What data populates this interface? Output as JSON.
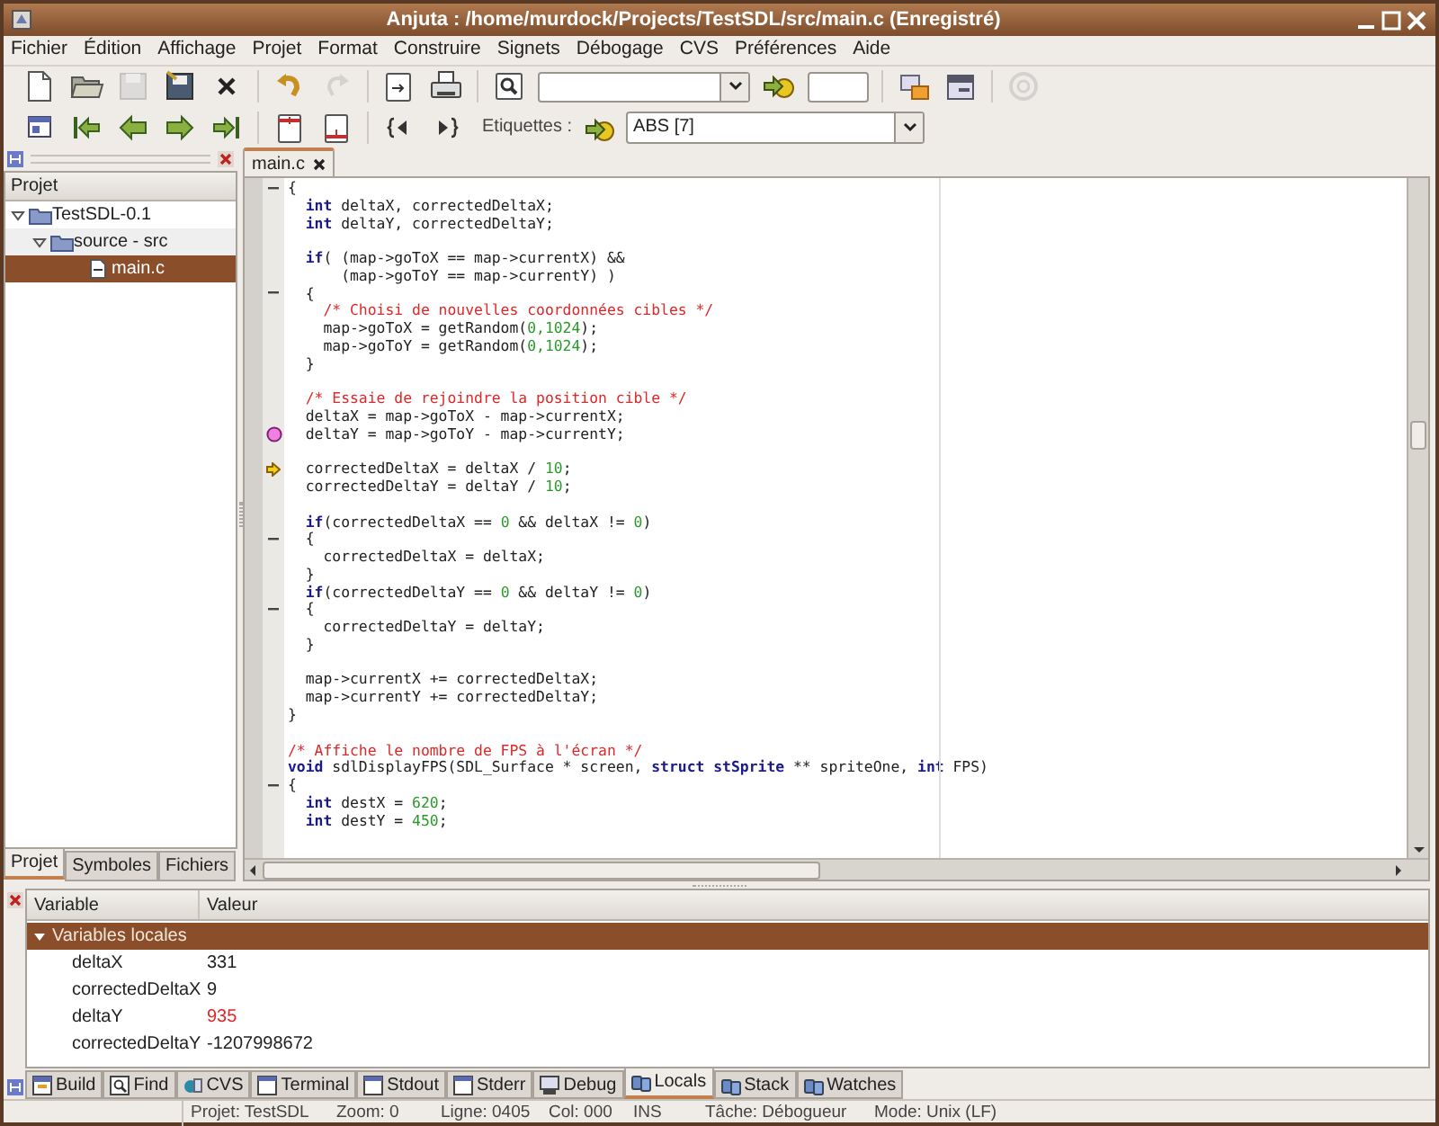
{
  "window": {
    "title": "Anjuta : /home/murdock/Projects/TestSDL/src/main.c (Enregistré)"
  },
  "menu": [
    "Fichier",
    "Édition",
    "Affichage",
    "Projet",
    "Format",
    "Construire",
    "Signets",
    "Débogage",
    "CVS",
    "Préférences",
    "Aide"
  ],
  "toolbar_1": [
    {
      "kind": "new",
      "disabled": false
    },
    {
      "kind": "open",
      "disabled": false
    },
    {
      "kind": "save",
      "disabled": true
    },
    {
      "kind": "save-all",
      "disabled": false
    },
    {
      "kind": "close",
      "disabled": false
    },
    {
      "kind": "sep"
    },
    {
      "kind": "undo",
      "disabled": false
    },
    {
      "kind": "redo",
      "disabled": true
    },
    {
      "kind": "sep"
    },
    {
      "kind": "import",
      "disabled": false
    },
    {
      "kind": "print",
      "disabled": false
    },
    {
      "kind": "sep"
    },
    {
      "kind": "find",
      "disabled": false
    },
    {
      "kind": "search-combo"
    },
    {
      "kind": "goto",
      "disabled": false
    },
    {
      "kind": "line-field"
    },
    {
      "kind": "sep"
    },
    {
      "kind": "windows",
      "disabled": false
    },
    {
      "kind": "panel",
      "disabled": false
    },
    {
      "kind": "sep"
    },
    {
      "kind": "stop",
      "disabled": true
    }
  ],
  "toolbar_2": [
    {
      "kind": "window",
      "disabled": false
    },
    {
      "kind": "first",
      "disabled": false
    },
    {
      "kind": "prev",
      "disabled": false
    },
    {
      "kind": "next",
      "disabled": false
    },
    {
      "kind": "last",
      "disabled": false
    },
    {
      "kind": "sep"
    },
    {
      "kind": "bookmark-up",
      "disabled": false
    },
    {
      "kind": "bookmark-down",
      "disabled": false
    },
    {
      "kind": "sep"
    },
    {
      "kind": "brace-prev",
      "disabled": false
    },
    {
      "kind": "brace-next",
      "disabled": false
    }
  ],
  "tags": {
    "label": "Etiquettes :",
    "value": "ABS [7]"
  },
  "project_panel": {
    "column": "Projet",
    "tree": [
      {
        "label": "TestSDL-0.1",
        "expanded": true,
        "selected": false,
        "children": [
          {
            "label": "source - src",
            "expanded": true,
            "selected": false,
            "children": [
              {
                "label": "main.c",
                "selected": true
              }
            ]
          }
        ]
      }
    ],
    "tabs": [
      {
        "label": "Projet",
        "selected": true
      },
      {
        "label": "Symboles",
        "selected": false
      },
      {
        "label": "Fichiers",
        "selected": false
      }
    ]
  },
  "editor": {
    "tabs": [
      {
        "label": "main.c",
        "selected": true
      }
    ],
    "lines": [
      {
        "kind": "code",
        "fold": true,
        "breakpoint": false,
        "current": false,
        "tokens": [
          {
            "kind": "plain",
            "text": "{"
          }
        ]
      },
      {
        "kind": "code",
        "fold": false,
        "breakpoint": false,
        "current": false,
        "tokens": [
          {
            "kind": "keyword",
            "text": "  int"
          },
          {
            "kind": "plain",
            "text": " deltaX, correctedDeltaX;"
          }
        ]
      },
      {
        "kind": "code",
        "fold": false,
        "breakpoint": false,
        "current": false,
        "tokens": [
          {
            "kind": "keyword",
            "text": "  int"
          },
          {
            "kind": "plain",
            "text": " deltaY, correctedDeltaY;"
          }
        ]
      },
      {
        "kind": "blank"
      },
      {
        "kind": "code",
        "fold": false,
        "breakpoint": false,
        "current": false,
        "tokens": [
          {
            "kind": "keyword",
            "text": "  if"
          },
          {
            "kind": "plain",
            "text": "( (map->goToX == map->currentX) &&"
          }
        ]
      },
      {
        "kind": "code",
        "fold": false,
        "breakpoint": false,
        "current": false,
        "tokens": [
          {
            "kind": "plain",
            "text": "      (map->goToY == map->currentY) )"
          }
        ]
      },
      {
        "kind": "code",
        "fold": true,
        "breakpoint": false,
        "current": false,
        "tokens": [
          {
            "kind": "plain",
            "text": "  {"
          }
        ]
      },
      {
        "kind": "code",
        "fold": false,
        "breakpoint": false,
        "current": false,
        "tokens": [
          {
            "kind": "comment",
            "text": "    /* Choisi de nouvelles coordonnées cibles */"
          }
        ]
      },
      {
        "kind": "code",
        "fold": false,
        "breakpoint": false,
        "current": false,
        "tokens": [
          {
            "kind": "plain",
            "text": "    map->goToX = getRandom("
          },
          {
            "kind": "number",
            "text": "0,1024"
          },
          {
            "kind": "plain",
            "text": ");"
          }
        ]
      },
      {
        "kind": "code",
        "fold": false,
        "breakpoint": false,
        "current": false,
        "tokens": [
          {
            "kind": "plain",
            "text": "    map->goToY = getRandom("
          },
          {
            "kind": "number",
            "text": "0,1024"
          },
          {
            "kind": "plain",
            "text": ");"
          }
        ]
      },
      {
        "kind": "code",
        "fold": false,
        "breakpoint": false,
        "current": false,
        "tokens": [
          {
            "kind": "plain",
            "text": "  }"
          }
        ]
      },
      {
        "kind": "blank"
      },
      {
        "kind": "code",
        "fold": false,
        "breakpoint": false,
        "current": false,
        "tokens": [
          {
            "kind": "comment",
            "text": "  /* Essaie de rejoindre la position cible */"
          }
        ]
      },
      {
        "kind": "code",
        "fold": false,
        "breakpoint": false,
        "current": false,
        "tokens": [
          {
            "kind": "plain",
            "text": "  deltaX = map->goToX - map->currentX;"
          }
        ]
      },
      {
        "kind": "code",
        "fold": false,
        "breakpoint": true,
        "current": false,
        "tokens": [
          {
            "kind": "plain",
            "text": "  deltaY = map->goToY - map->currentY;"
          }
        ]
      },
      {
        "kind": "blank"
      },
      {
        "kind": "code",
        "fold": false,
        "breakpoint": false,
        "current": true,
        "tokens": [
          {
            "kind": "plain",
            "text": "  correctedDeltaX = deltaX / "
          },
          {
            "kind": "number",
            "text": "10"
          },
          {
            "kind": "plain",
            "text": ";"
          }
        ]
      },
      {
        "kind": "code",
        "fold": false,
        "breakpoint": false,
        "current": false,
        "tokens": [
          {
            "kind": "plain",
            "text": "  correctedDeltaY = deltaY / "
          },
          {
            "kind": "number",
            "text": "10"
          },
          {
            "kind": "plain",
            "text": ";"
          }
        ]
      },
      {
        "kind": "blank"
      },
      {
        "kind": "code",
        "fold": false,
        "breakpoint": false,
        "current": false,
        "tokens": [
          {
            "kind": "keyword",
            "text": "  if"
          },
          {
            "kind": "plain",
            "text": "(correctedDeltaX == "
          },
          {
            "kind": "number",
            "text": "0"
          },
          {
            "kind": "plain",
            "text": " && deltaX != "
          },
          {
            "kind": "number",
            "text": "0"
          },
          {
            "kind": "plain",
            "text": ")"
          }
        ]
      },
      {
        "kind": "code",
        "fold": true,
        "breakpoint": false,
        "current": false,
        "tokens": [
          {
            "kind": "plain",
            "text": "  {"
          }
        ]
      },
      {
        "kind": "code",
        "fold": false,
        "breakpoint": false,
        "current": false,
        "tokens": [
          {
            "kind": "plain",
            "text": "    correctedDeltaX = deltaX;"
          }
        ]
      },
      {
        "kind": "code",
        "fold": false,
        "breakpoint": false,
        "current": false,
        "tokens": [
          {
            "kind": "plain",
            "text": "  }"
          }
        ]
      },
      {
        "kind": "code",
        "fold": false,
        "breakpoint": false,
        "current": false,
        "tokens": [
          {
            "kind": "keyword",
            "text": "  if"
          },
          {
            "kind": "plain",
            "text": "(correctedDeltaY == "
          },
          {
            "kind": "number",
            "text": "0"
          },
          {
            "kind": "plain",
            "text": " && deltaY != "
          },
          {
            "kind": "number",
            "text": "0"
          },
          {
            "kind": "plain",
            "text": ")"
          }
        ]
      },
      {
        "kind": "code",
        "fold": true,
        "breakpoint": false,
        "current": false,
        "tokens": [
          {
            "kind": "plain",
            "text": "  {"
          }
        ]
      },
      {
        "kind": "code",
        "fold": false,
        "breakpoint": false,
        "current": false,
        "tokens": [
          {
            "kind": "plain",
            "text": "    correctedDeltaY = deltaY;"
          }
        ]
      },
      {
        "kind": "code",
        "fold": false,
        "breakpoint": false,
        "current": false,
        "tokens": [
          {
            "kind": "plain",
            "text": "  }"
          }
        ]
      },
      {
        "kind": "blank"
      },
      {
        "kind": "code",
        "fold": false,
        "breakpoint": false,
        "current": false,
        "tokens": [
          {
            "kind": "plain",
            "text": "  map->currentX += correctedDeltaX;"
          }
        ]
      },
      {
        "kind": "code",
        "fold": false,
        "breakpoint": false,
        "current": false,
        "tokens": [
          {
            "kind": "plain",
            "text": "  map->currentY += correctedDeltaY;"
          }
        ]
      },
      {
        "kind": "code",
        "fold": false,
        "breakpoint": false,
        "current": false,
        "tokens": [
          {
            "kind": "plain",
            "text": "}"
          }
        ]
      },
      {
        "kind": "blank"
      },
      {
        "kind": "code",
        "fold": false,
        "breakpoint": false,
        "current": false,
        "tokens": [
          {
            "kind": "comment",
            "text": "/* Affiche le nombre de FPS à l'écran */"
          }
        ]
      },
      {
        "kind": "code",
        "fold": false,
        "breakpoint": false,
        "current": false,
        "tokens": [
          {
            "kind": "keyword",
            "text": "void"
          },
          {
            "kind": "plain",
            "text": " sdlDisplayFPS(SDL_Surface * screen, "
          },
          {
            "kind": "keyword",
            "text": "struct stSprite"
          },
          {
            "kind": "plain",
            "text": " ** spriteOne, "
          },
          {
            "kind": "keyword",
            "text": "int"
          },
          {
            "kind": "plain",
            "text": " FPS)"
          }
        ]
      },
      {
        "kind": "code",
        "fold": true,
        "breakpoint": false,
        "current": false,
        "tokens": [
          {
            "kind": "plain",
            "text": "{"
          }
        ]
      },
      {
        "kind": "code",
        "fold": false,
        "breakpoint": false,
        "current": false,
        "tokens": [
          {
            "kind": "keyword",
            "text": "  int"
          },
          {
            "kind": "plain",
            "text": " destX = "
          },
          {
            "kind": "number",
            "text": "620"
          },
          {
            "kind": "plain",
            "text": ";"
          }
        ]
      },
      {
        "kind": "code",
        "fold": false,
        "breakpoint": false,
        "current": false,
        "tokens": [
          {
            "kind": "keyword",
            "text": "  int"
          },
          {
            "kind": "plain",
            "text": " destY = "
          },
          {
            "kind": "number",
            "text": "450"
          },
          {
            "kind": "plain",
            "text": ";"
          }
        ]
      }
    ]
  },
  "locals": {
    "columns": [
      "Variable",
      "Valeur"
    ],
    "group": {
      "label": "Variables locales",
      "expanded": true,
      "selected": true
    },
    "rows": [
      {
        "name": "deltaX",
        "value": "331",
        "changed": false
      },
      {
        "name": "correctedDeltaX",
        "value": "9",
        "changed": false
      },
      {
        "name": "deltaY",
        "value": "935",
        "changed": true
      },
      {
        "name": "correctedDeltaY",
        "value": "-1207998672",
        "changed": false
      }
    ]
  },
  "bottom_tabs": [
    {
      "label": "Build",
      "kind": "build",
      "selected": false
    },
    {
      "label": "Find",
      "kind": "find",
      "selected": false
    },
    {
      "label": "CVS",
      "kind": "cvs",
      "selected": false
    },
    {
      "label": "Terminal",
      "kind": "term",
      "selected": false
    },
    {
      "label": "Stdout",
      "kind": "term",
      "selected": false
    },
    {
      "label": "Stderr",
      "kind": "term",
      "selected": false
    },
    {
      "label": "Debug",
      "kind": "debug",
      "selected": false
    },
    {
      "label": "Locals",
      "kind": "watch",
      "selected": true
    },
    {
      "label": "Stack",
      "kind": "watch",
      "selected": false
    },
    {
      "label": "Watches",
      "kind": "watch",
      "selected": false
    }
  ],
  "status_bar": [
    "Projet: TestSDL",
    "Zoom: 0",
    "Ligne: 0405",
    "Col: 000",
    "INS",
    "Tâche: Débogueur",
    "Mode: Unix (LF)"
  ]
}
